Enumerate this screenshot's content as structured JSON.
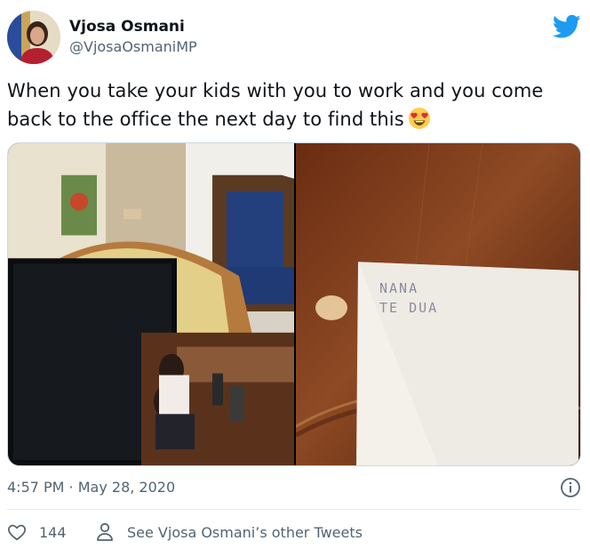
{
  "author": {
    "display_name": "Vjosa Osmani",
    "handle": "@VjosaOsmaniMP"
  },
  "icons": {
    "brand": "twitter-bird-icon",
    "emoji": "heart-eyes-emoji",
    "info": "info-icon",
    "like": "heart-icon",
    "profile": "person-icon"
  },
  "tweet": {
    "text": "When you take your kids with you to work and you come back to the office the next day to find this"
  },
  "media": {
    "note_line1": "NANA",
    "note_line2": "TE DUA"
  },
  "meta": {
    "timestamp": "4:57 PM · May 28, 2020"
  },
  "actions": {
    "like_count": "144",
    "other_tweets": "See Vjosa Osmani’s other Tweets"
  },
  "colors": {
    "brand_blue": "#1d9bf0",
    "secondary_text": "#536471",
    "primary_text": "#0f1419",
    "divider": "#e6ecf0"
  }
}
